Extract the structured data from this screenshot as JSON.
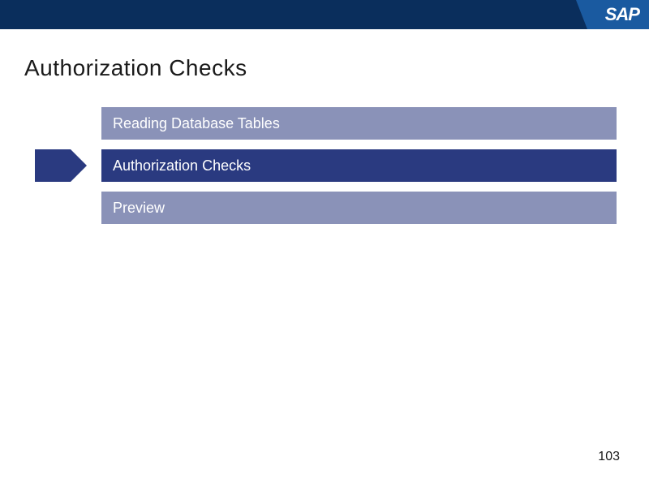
{
  "header": {
    "logo_text": "SAP"
  },
  "slide": {
    "title": "Authorization Checks",
    "page_number": "103"
  },
  "agenda": {
    "items": [
      {
        "label": "Reading Database Tables",
        "active": false
      },
      {
        "label": "Authorization Checks",
        "active": true
      },
      {
        "label": "Preview",
        "active": false
      }
    ]
  }
}
